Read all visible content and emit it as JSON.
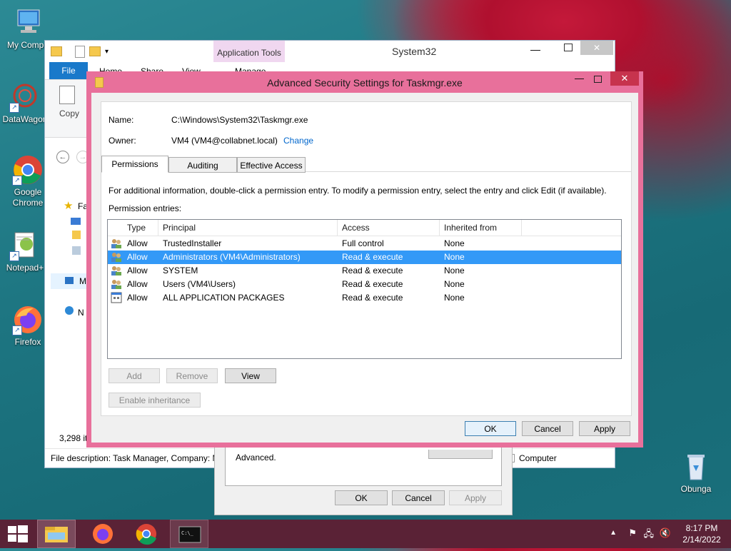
{
  "desktop": {
    "icons": [
      {
        "label": "My Compu"
      },
      {
        "label": "DataWagon"
      },
      {
        "label": "Google Chrome"
      },
      {
        "label": "Notepad+"
      },
      {
        "label": "Firefox"
      },
      {
        "label": "Obunga"
      }
    ]
  },
  "explorer": {
    "title": "System32",
    "app_tools": "Application Tools",
    "tabs": [
      "File",
      "Home",
      "Share",
      "View",
      "Manage"
    ],
    "copy_label": "Copy",
    "nav_fa": "Fa",
    "nav_m": "M",
    "nav_n": "N",
    "item_count": "3,298 it",
    "status": "File description: Task Manager, Company: M",
    "status_right": "Computer"
  },
  "props_dialog": {
    "text": "Advanced.",
    "ok": "OK",
    "cancel": "Cancel",
    "apply": "Apply"
  },
  "dialog": {
    "title": "Advanced Security Settings for Taskmgr.exe",
    "name_label": "Name:",
    "name_value": "C:\\Windows\\System32\\Taskmgr.exe",
    "owner_label": "Owner:",
    "owner_value": "VM4 (VM4@collabnet.local)",
    "change_link": "Change",
    "tabs": [
      "Permissions",
      "Auditing",
      "Effective Access"
    ],
    "info": "For additional information, double-click a permission entry. To modify a permission entry, select the entry and click Edit (if available).",
    "entries_label": "Permission entries:",
    "columns": [
      "Type",
      "Principal",
      "Access",
      "Inherited from"
    ],
    "rows": [
      {
        "type": "Allow",
        "principal": "TrustedInstaller",
        "access": "Full control",
        "inherited": "None"
      },
      {
        "type": "Allow",
        "principal": "Administrators (VM4\\Administrators)",
        "access": "Read & execute",
        "inherited": "None"
      },
      {
        "type": "Allow",
        "principal": "SYSTEM",
        "access": "Read & execute",
        "inherited": "None"
      },
      {
        "type": "Allow",
        "principal": "Users (VM4\\Users)",
        "access": "Read & execute",
        "inherited": "None"
      },
      {
        "type": "Allow",
        "principal": "ALL APPLICATION PACKAGES",
        "access": "Read & execute",
        "inherited": "None"
      }
    ],
    "selected_row": 1,
    "add": "Add",
    "remove": "Remove",
    "view": "View",
    "enable_inheritance": "Enable inheritance",
    "ok": "OK",
    "cancel": "Cancel",
    "apply": "Apply"
  },
  "taskbar": {
    "time": "8:17 PM",
    "date": "2/14/2022"
  },
  "colors": {
    "dialog_frame": "#e8709b",
    "selection": "#3399f7",
    "taskbar": "#5a2236",
    "file_tab": "#1979ca"
  }
}
